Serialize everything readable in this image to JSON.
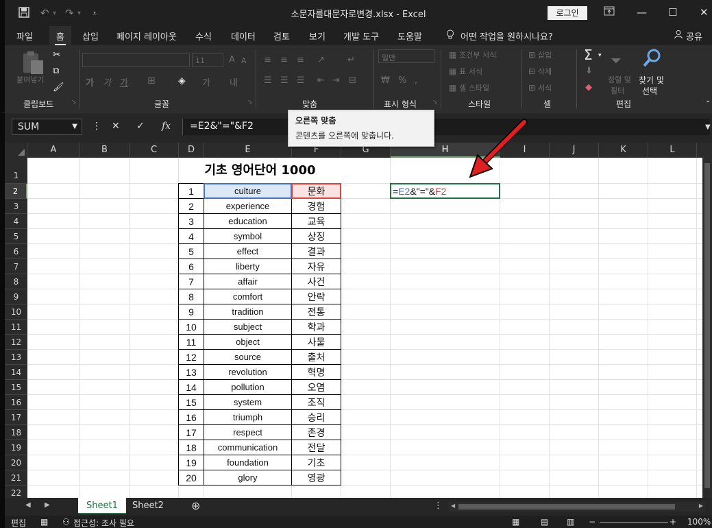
{
  "window": {
    "title": "소문자를대문자로변경.xlsx  -  Excel",
    "login_label": "로그인",
    "share_label": "공유"
  },
  "tabs": [
    "파일",
    "홈",
    "삽입",
    "페이지 레이아웃",
    "수식",
    "데이터",
    "검토",
    "보기",
    "개발 도구",
    "도움말",
    "어떤 작업을 원하시나요?"
  ],
  "ribbon": {
    "clipboard": {
      "label": "클립보드",
      "paste": "붙여넣기"
    },
    "font": {
      "label": "글꼴",
      "font_name": "",
      "font_size": "11"
    },
    "alignment": {
      "label": "맞춤"
    },
    "number": {
      "label": "표시 형식",
      "format": "일반"
    },
    "styles": {
      "label": "스타일",
      "conditional": "조건부 서식",
      "table": "표 서식",
      "cell_styles": "셀 스타일"
    },
    "cells": {
      "label": "셀",
      "insert": "삽입",
      "delete": "삭제",
      "format": "서식"
    },
    "editing": {
      "label": "편집",
      "sort_filter_1": "정렬 및",
      "sort_filter_2": "필터",
      "find_1": "찾기 및",
      "find_2": "선택"
    }
  },
  "formula_bar": {
    "name_box": "SUM",
    "formula": "=E2&\"=\"&F2"
  },
  "tooltip": {
    "title": "오른쪽 맞춤",
    "description": "콘텐츠를 오른쪽에 맞춥니다."
  },
  "columns": [
    "A",
    "B",
    "C",
    "D",
    "E",
    "F",
    "G",
    "H",
    "I",
    "J",
    "K",
    "L"
  ],
  "rows": [
    "1",
    "2",
    "3",
    "4",
    "5",
    "6",
    "7",
    "8",
    "9",
    "10",
    "11",
    "12",
    "13",
    "14",
    "15",
    "16",
    "17",
    "18",
    "19",
    "20",
    "21",
    "22"
  ],
  "sheet": {
    "title": "기초 영어단어 1000",
    "table": [
      {
        "num": "1",
        "word": "culture",
        "meaning": "문화"
      },
      {
        "num": "2",
        "word": "experience",
        "meaning": "경험"
      },
      {
        "num": "3",
        "word": "education",
        "meaning": "교육"
      },
      {
        "num": "4",
        "word": "symbol",
        "meaning": "상징"
      },
      {
        "num": "5",
        "word": "effect",
        "meaning": "결과"
      },
      {
        "num": "6",
        "word": "liberty",
        "meaning": "자유"
      },
      {
        "num": "7",
        "word": "affair",
        "meaning": "사건"
      },
      {
        "num": "8",
        "word": "comfort",
        "meaning": "안락"
      },
      {
        "num": "9",
        "word": "tradition",
        "meaning": "전통"
      },
      {
        "num": "10",
        "word": "subject",
        "meaning": "학과"
      },
      {
        "num": "11",
        "word": "object",
        "meaning": "사물"
      },
      {
        "num": "12",
        "word": "source",
        "meaning": "출처"
      },
      {
        "num": "13",
        "word": "revolution",
        "meaning": "혁명"
      },
      {
        "num": "14",
        "word": "pollution",
        "meaning": "오염"
      },
      {
        "num": "15",
        "word": "system",
        "meaning": "조직"
      },
      {
        "num": "16",
        "word": "triumph",
        "meaning": "승리"
      },
      {
        "num": "17",
        "word": "respect",
        "meaning": "존경"
      },
      {
        "num": "18",
        "word": "communication",
        "meaning": "전달"
      },
      {
        "num": "19",
        "word": "foundation",
        "meaning": "기초"
      },
      {
        "num": "20",
        "word": "glory",
        "meaning": "영광"
      }
    ],
    "edit_cell": {
      "eq": "=",
      "ref1": "E2",
      "mid": "&\"=\"&",
      "ref2": "F2"
    }
  },
  "sheet_tabs": [
    "Sheet1",
    "Sheet2"
  ],
  "status": {
    "mode": "편집",
    "accessibility": "접근성: 조사 필요",
    "zoom": "100%"
  },
  "colors": {
    "ref1": "#4472c4",
    "ref2": "#e0433b",
    "selection_border": "#217346",
    "arrow": "#e02020"
  }
}
